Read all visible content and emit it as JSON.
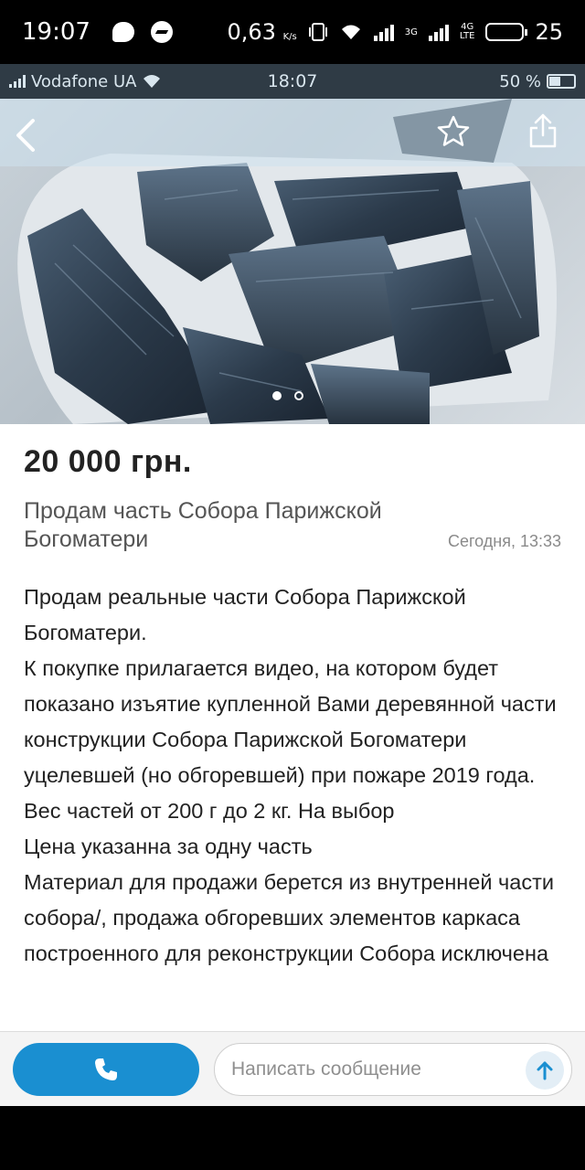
{
  "phone_status": {
    "time": "19:07",
    "speed": "0,63",
    "speed_unit": "K/s",
    "network_3g": "3G",
    "network_4g": "4G",
    "network_lte": "LTE",
    "battery": "25"
  },
  "screenshot_status": {
    "carrier": "Vodafone UA",
    "time": "18:07",
    "battery": "50 %"
  },
  "gallery": {
    "image_icon": "charcoal-photo",
    "slide_count": 2,
    "active_slide": 1
  },
  "listing": {
    "price": "20 000 грн.",
    "title": "Продам часть Собора Парижской Богоматери",
    "date": "Сегодня, 13:33",
    "description": "Продам реальные части Собора Парижской Богоматери.\nК покупке прилагается видео, на котором будет показано изъятие купленной Вами деревянной части конструкции Собора Парижской Богоматери уцелевшей (но обгоревшей) при пожаре 2019 года.\nВес частей от 200 г до 2 кг. На выбор\nЦена указанна за одну часть\nМатериал для продажи берется из внутренней части собора/, продажа обгоревших элементов каркаса построенного для реконструкции Собора исключена"
  },
  "actions": {
    "message_placeholder": "Написать сообщение"
  },
  "colors": {
    "accent": "#1a8fd1",
    "price_text": "#222222",
    "muted_text": "#8a8a8a"
  }
}
